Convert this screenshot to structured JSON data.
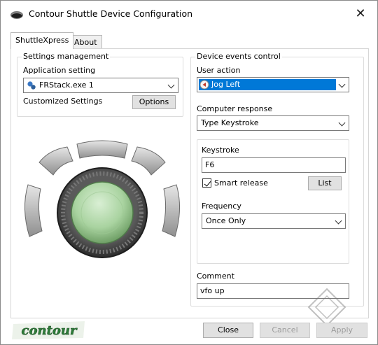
{
  "window": {
    "title": "Contour Shuttle Device Configuration"
  },
  "tabs": [
    {
      "label": "ShuttleXpress",
      "active": true
    },
    {
      "label": "About",
      "active": false
    }
  ],
  "settings_management": {
    "title": "Settings management",
    "application_label": "Application setting",
    "application_value": "FRStack.exe 1",
    "customized_label": "Customized Settings",
    "options_button": "Options"
  },
  "device_events": {
    "title": "Device events control",
    "user_action_label": "User action",
    "user_action_value": "Jog Left",
    "computer_response_label": "Computer response",
    "computer_response_value": "Type Keystroke",
    "keystroke_label": "Keystroke",
    "keystroke_value": "F6",
    "smart_release_label": "Smart release",
    "smart_release_checked": true,
    "list_button": "List",
    "frequency_label": "Frequency",
    "frequency_value": "Once Only",
    "comment_label": "Comment",
    "comment_value": "vfo up"
  },
  "footer": {
    "logo_text": "contour",
    "close_button": "Close",
    "cancel_button": "Cancel",
    "apply_button": "Apply",
    "cancel_enabled": false,
    "apply_enabled": false
  },
  "colors": {
    "selection": "#0078d7",
    "knob_green": "#a9d3a0",
    "logo_green": "#2e7d3a",
    "button_face": "#e1e1e1"
  }
}
